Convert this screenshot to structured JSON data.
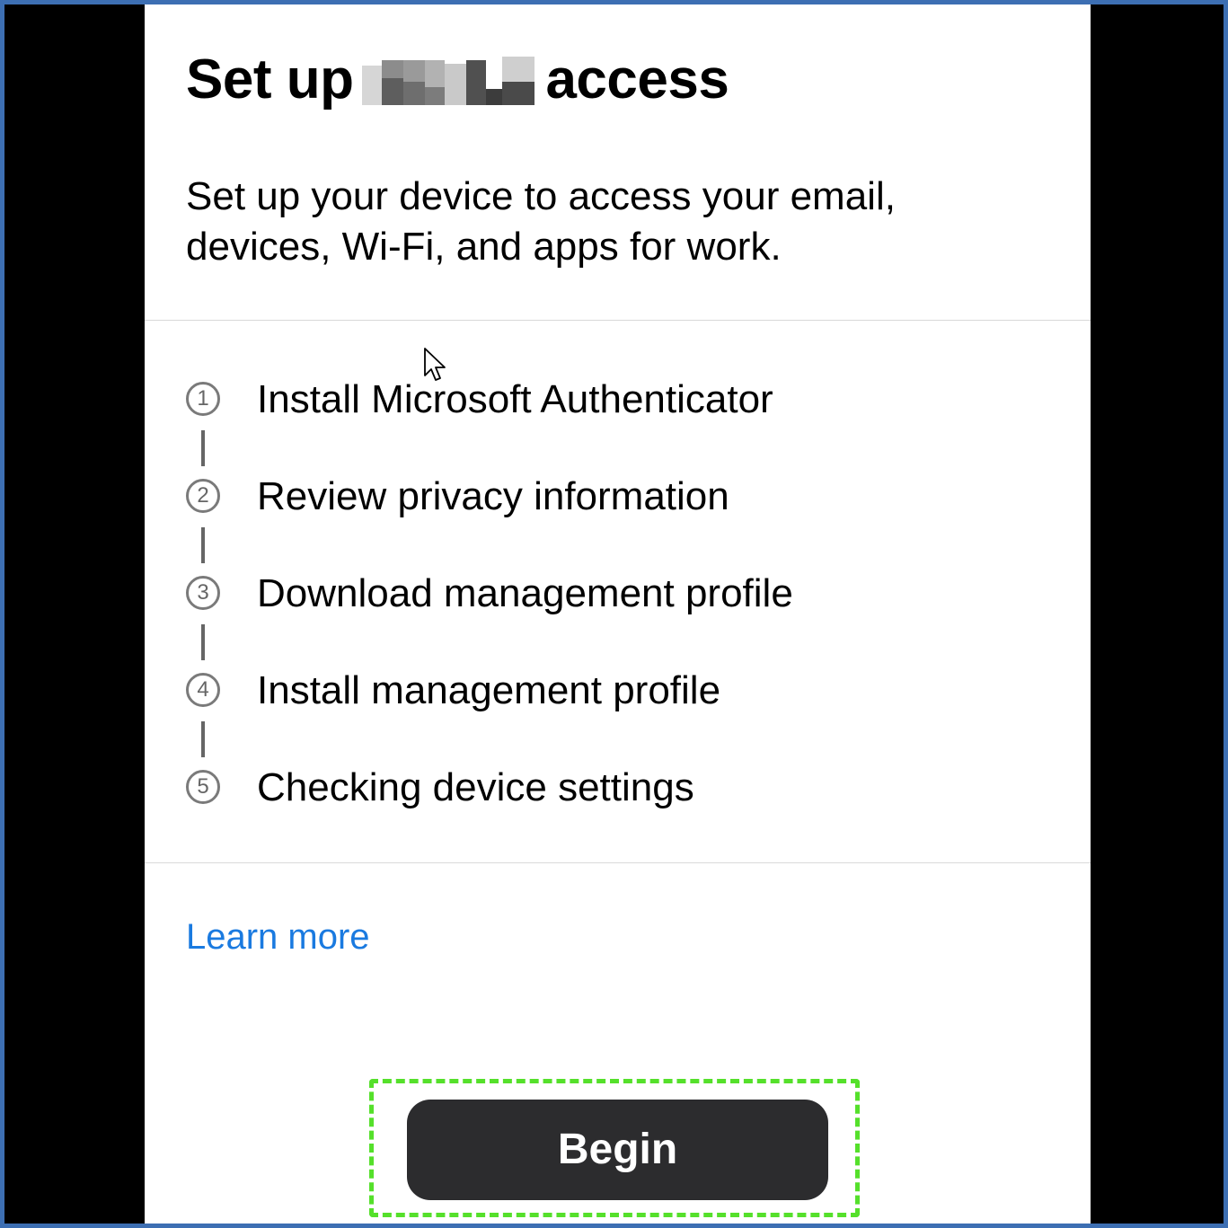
{
  "page": {
    "title_prefix": "Set up",
    "title_suffix": "access",
    "subtitle": "Set up your device to access your email, devices, Wi-Fi, and apps for work."
  },
  "steps": [
    {
      "number": "1",
      "label": "Install Microsoft Authenticator"
    },
    {
      "number": "2",
      "label": "Review privacy information"
    },
    {
      "number": "3",
      "label": "Download management profile"
    },
    {
      "number": "4",
      "label": "Install management profile"
    },
    {
      "number": "5",
      "label": "Checking device settings"
    }
  ],
  "links": {
    "learn_more": "Learn more"
  },
  "actions": {
    "begin_label": "Begin"
  },
  "colors": {
    "link": "#1a7ae0",
    "button_bg": "#2c2c2e",
    "highlight": "#55e02b",
    "frame": "#3D6FB3"
  },
  "icons": {
    "cursor": "pointer-cursor-icon",
    "redaction": "pixelated-redaction"
  }
}
